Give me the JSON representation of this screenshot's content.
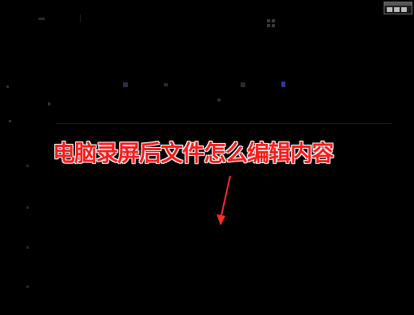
{
  "caption": {
    "text": "电脑录屏后文件怎么编辑内容",
    "color": "#ff1a1a",
    "outline_color": "#ffffff"
  },
  "arrow": {
    "color": "#ff2a2a"
  },
  "window_badge": {
    "icon": "window-icon"
  }
}
